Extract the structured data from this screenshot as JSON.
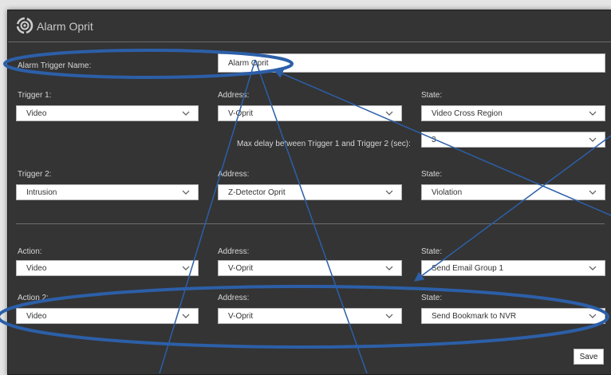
{
  "window": {
    "title": "Alarm Oprit"
  },
  "alarm_trigger_name": {
    "label": "Alarm Trigger Name:",
    "value": "Alarm Oprit"
  },
  "trigger1": {
    "label": "Trigger 1:",
    "value": "Video",
    "address_label": "Address:",
    "address_value": "V-Oprit",
    "state_label": "State:",
    "state_value": "Video Cross Region"
  },
  "max_delay": {
    "label": "Max delay between Trigger 1 and Trigger 2 (sec):",
    "value": "3"
  },
  "trigger2": {
    "label": "Trigger 2:",
    "value": "Intrusion",
    "address_label": "Address:",
    "address_value": "Z-Detector Oprit",
    "state_label": "State:",
    "state_value": "Violation"
  },
  "action1": {
    "label": "Action:",
    "value": "Video",
    "address_label": "Address:",
    "address_value": "V-Oprit",
    "state_label": "State:",
    "state_value": "Send Email Group 1"
  },
  "action2": {
    "label": "Action 2:",
    "value": "Video",
    "address_label": "Address:",
    "address_value": "V-Oprit",
    "state_label": "State:",
    "state_value": "Send Bookmark to NVR"
  },
  "buttons": {
    "save": "Save"
  },
  "icons": {
    "logo": "alarm-logo-icon",
    "dropdown": "chevron-down-icon"
  },
  "colors": {
    "annotation": "#2c5fa8",
    "window_bg": "#343434",
    "field_bg": "#ffffff"
  }
}
